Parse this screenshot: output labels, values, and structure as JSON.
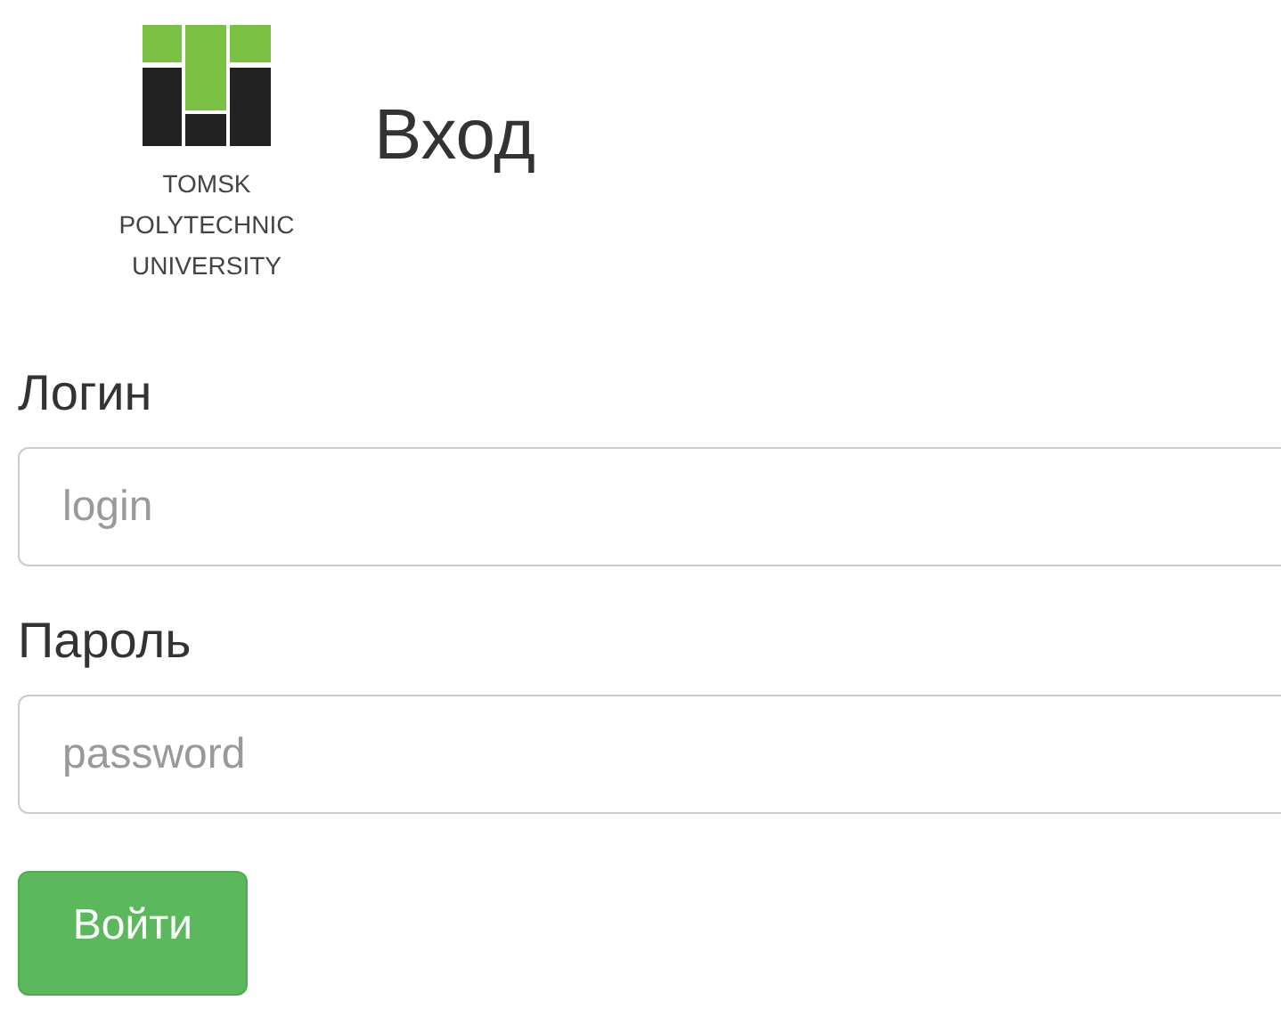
{
  "logo": {
    "lines": [
      "TOMSK",
      "POLYTECHNIC",
      "UNIVERSITY"
    ]
  },
  "title": "Вход",
  "fields": [
    {
      "label": "Логин",
      "placeholder": "login"
    },
    {
      "label": "Пароль",
      "placeholder": "password"
    }
  ],
  "button": "Войти"
}
